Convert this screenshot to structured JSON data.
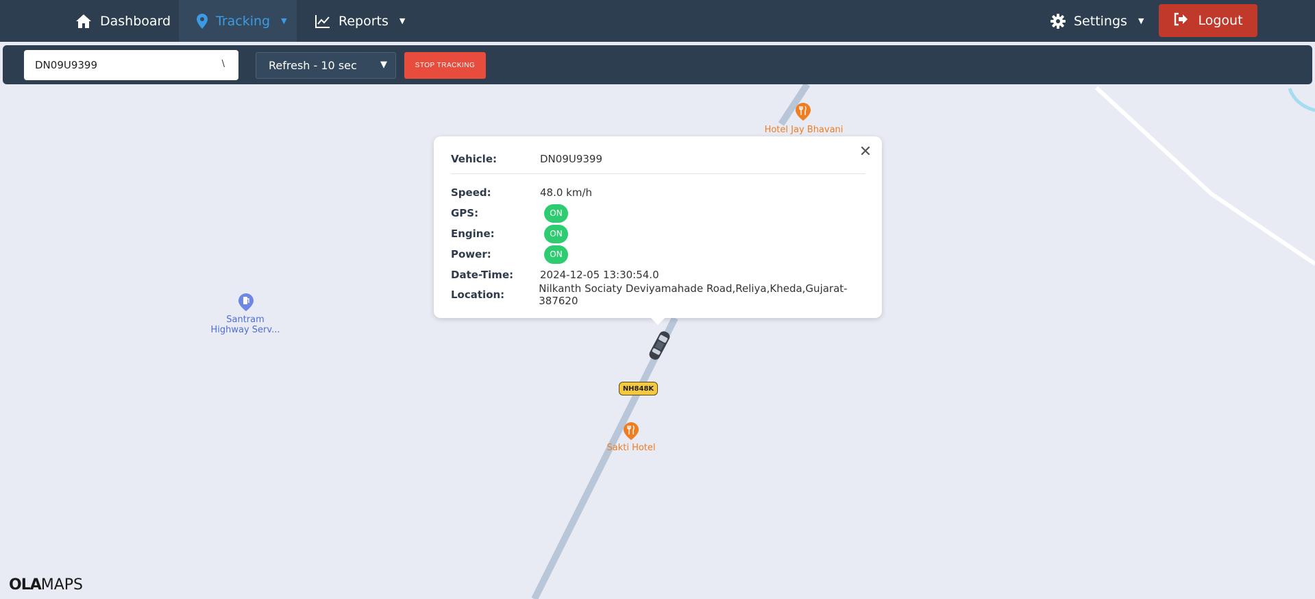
{
  "nav": {
    "dashboard": "Dashboard",
    "tracking": "Tracking",
    "reports": "Reports",
    "settings": "Settings",
    "logout": "Logout"
  },
  "toolbar": {
    "vehicle_value": "DN09U9399",
    "refresh_value": "Refresh - 10 sec",
    "stop_label": "STOP TRACKING"
  },
  "map": {
    "pois": {
      "hotel_jay_bhavani": "Hotel Jay Bhavani",
      "santram": "Santram",
      "santram_line2": "Highway Serv...",
      "sakti_hotel": "Sakti Hotel"
    },
    "road_shield": "NH848K",
    "logo_bold": "OLA",
    "logo_light": "MAPS"
  },
  "popup": {
    "vehicle_label": "Vehicle:",
    "vehicle_value": "DN09U9399",
    "speed_label": "Speed:",
    "speed_value": "48.0 km/h",
    "gps_label": "GPS:",
    "gps_value": "ON",
    "engine_label": "Engine:",
    "engine_value": "ON",
    "power_label": "Power:",
    "power_value": "ON",
    "datetime_label": "Date-Time:",
    "datetime_value": "2024-12-05 13:30:54.0",
    "location_label": "Location:",
    "location_value": "Nilkanth Sociaty Deviyamahade Road,Reliya,Kheda,Gujarat-387620"
  },
  "colors": {
    "navbar": "#2c3e50",
    "active_tab_text": "#3c9be4",
    "logout_bg": "#c0392b",
    "stop_bg": "#e74c3c",
    "badge_on": "#2ecc71",
    "map_bg": "#e8eaf4",
    "road": "#b8c6d8",
    "poi_orange": "#ef7d22",
    "poi_blue": "#4e6fd6"
  },
  "icons": {
    "dashboard": "home-icon",
    "tracking": "map-pin-icon",
    "reports": "line-chart-icon",
    "settings": "gear-icon",
    "logout": "sign-out-icon",
    "close": "close-icon"
  }
}
